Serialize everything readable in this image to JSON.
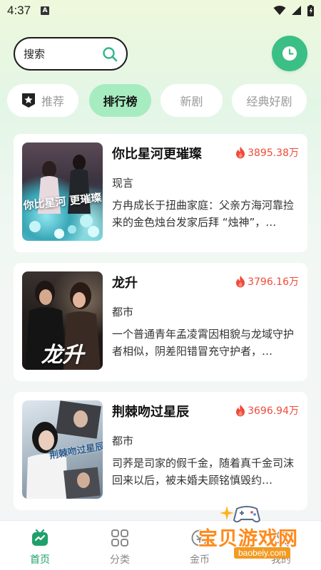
{
  "status_bar": {
    "time": "4:37",
    "notification_icon": "A"
  },
  "search": {
    "placeholder": "搜索"
  },
  "tabs": [
    {
      "label": "推荐",
      "icon": "star-badge-icon"
    },
    {
      "label": "排行榜",
      "active": true
    },
    {
      "label": "新剧"
    },
    {
      "label": "经典好剧"
    }
  ],
  "dramas": [
    {
      "title": "你比星河更璀璨",
      "heat": "3895.38万",
      "genre": "现言",
      "description": "方冉成长于扭曲家庭：父亲方海河靠捡来的金色烛台发家后拜 “烛神”，…",
      "cover_text": "你比星河 更璀璨"
    },
    {
      "title": "龙升",
      "heat": "3796.16万",
      "genre": "都市",
      "description": "一个普通青年孟凌霄因相貌与龙域守护者相似，阴差阳错冒充守护者，…",
      "cover_text": "龙升"
    },
    {
      "title": "荆棘吻过星辰",
      "heat": "3696.94万",
      "genre": "都市",
      "description": "司荞是司家的假千金，随着真千金司沫回来以后，被未婚夫顾铭慎毁约…",
      "cover_text": "荆棘吻过星辰"
    }
  ],
  "bottom_nav": [
    {
      "label": "首页",
      "icon": "tv-icon",
      "active": true
    },
    {
      "label": "分类",
      "icon": "grid-icon"
    },
    {
      "label": "金币",
      "icon": "coin-icon"
    },
    {
      "label": "我的",
      "icon": "user-icon"
    }
  ],
  "watermark": {
    "text": "宝贝游戏网",
    "url": "baobeiy.com"
  },
  "colors": {
    "accent": "#3cbf86",
    "active_tab": "#a6ecc0",
    "heat": "#f04a3a",
    "nav_active": "#1fa06a"
  }
}
